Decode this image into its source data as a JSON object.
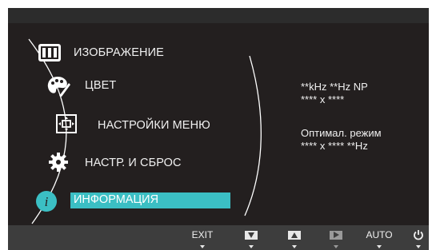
{
  "menu": {
    "items": [
      {
        "label": "ИЗОБРАЖЕНИЕ",
        "icon": "picture-icon"
      },
      {
        "label": "ЦВЕТ",
        "icon": "palette-icon"
      },
      {
        "label": "НАСТРОЙКИ МЕНЮ",
        "icon": "menu-settings-icon"
      },
      {
        "label": "НАСТР. И СБРОС",
        "icon": "gear-icon"
      },
      {
        "label": "ИНФОРМАЦИЯ",
        "icon": "info-icon"
      }
    ],
    "selected": "ИНФОРМАЦИЯ",
    "accent_color": "#3bbfc4"
  },
  "info_panel": {
    "signal_line1": "**kHz **Hz NP",
    "signal_line2": "**** x ****",
    "optimal_label": "Оптимал. режим",
    "optimal_value": "**** x **** **Hz"
  },
  "bottom_bar": {
    "exit_label": "EXIT",
    "down_icon": "down-arrow-icon",
    "up_icon": "up-arrow-icon",
    "enter_icon": "right-arrow-icon",
    "auto_label": "AUTO",
    "power_icon": "power-icon"
  }
}
